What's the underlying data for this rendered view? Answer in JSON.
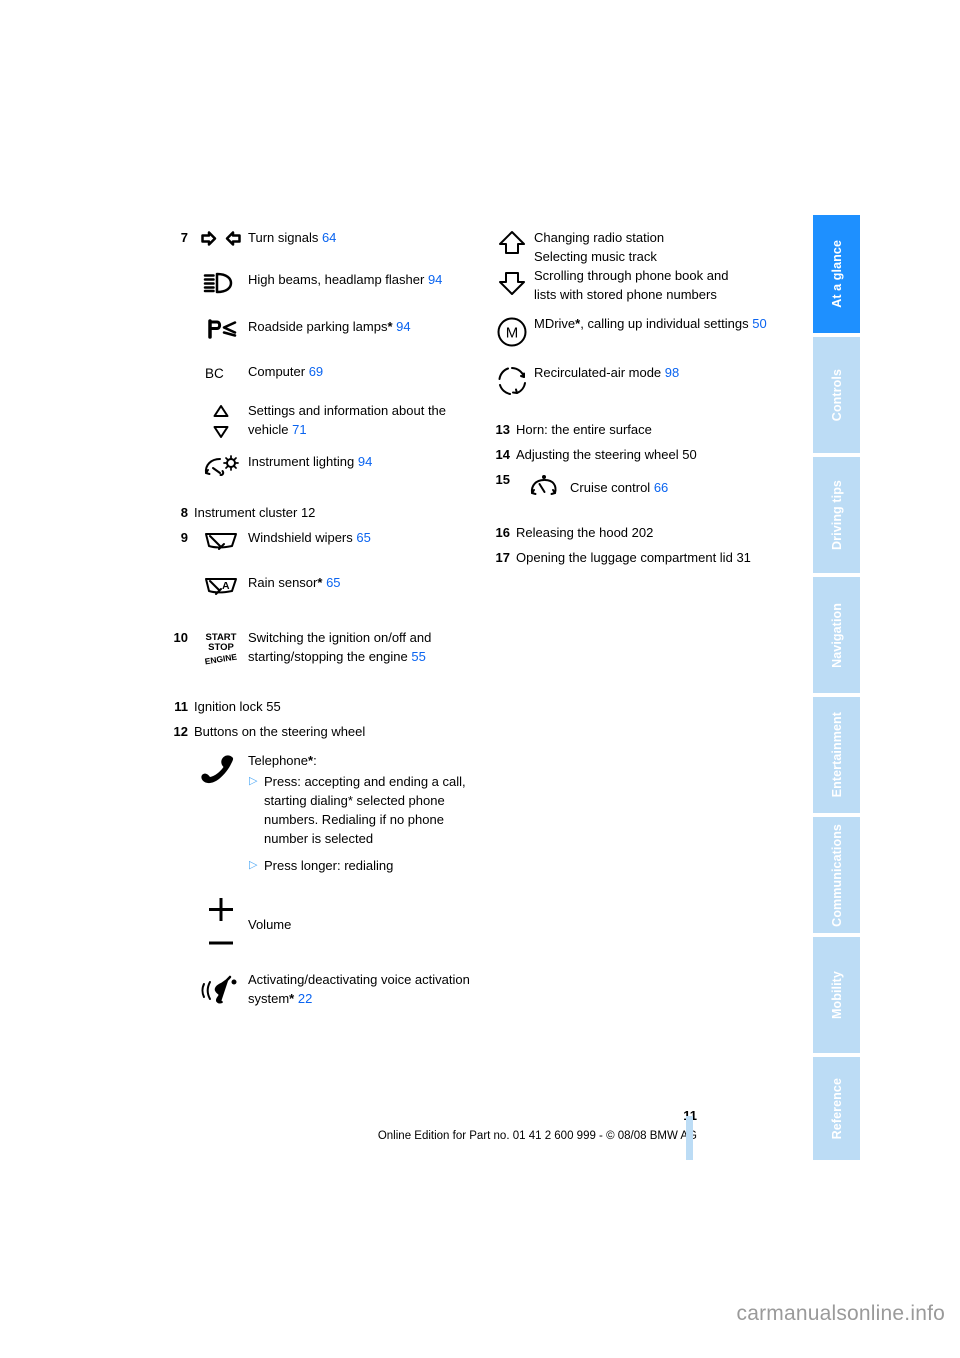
{
  "sidebar": {
    "tabs": [
      {
        "label": "At a glance",
        "active": true
      },
      {
        "label": "Controls",
        "active": false
      },
      {
        "label": "Driving tips",
        "active": false
      },
      {
        "label": "Navigation",
        "active": false
      },
      {
        "label": "Entertainment",
        "active": false
      },
      {
        "label": "Communications",
        "active": false
      },
      {
        "label": "Mobility",
        "active": false
      },
      {
        "label": "Reference",
        "active": false
      }
    ],
    "active_color": "#1e90ff",
    "inactive_color": "#bcdcf5"
  },
  "colors": {
    "reference_link": "#0a64f0",
    "bullet_triangle": "#4ea8f5",
    "watermark": "#9a9a9a"
  },
  "left_column": {
    "item7": {
      "number": "7",
      "entries": [
        {
          "icon": "turn-signals-icon",
          "label": "Turn signals",
          "ref": "64"
        },
        {
          "icon": "high-beams-icon",
          "label": "High beams, headlamp flasher",
          "ref": "94"
        },
        {
          "icon": "roadside-parking-lamps-icon",
          "label": "Roadside parking lamps",
          "star": "*",
          "ref": "94"
        },
        {
          "icon": "bc-computer-icon",
          "label": "Computer",
          "ref": "69"
        },
        {
          "icon": "up-down-arrows-icon",
          "label": "Settings and information about the vehicle",
          "ref": "71"
        },
        {
          "icon": "instrument-lighting-icon",
          "label": "Instrument lighting",
          "ref": "94"
        }
      ]
    },
    "item8": {
      "number": "8",
      "label": "Instrument cluster",
      "ref": "12"
    },
    "item9": {
      "number": "9",
      "entries": [
        {
          "icon": "windshield-wipers-icon",
          "label": "Windshield wipers",
          "ref": "65"
        },
        {
          "icon": "rain-sensor-icon",
          "label": "Rain sensor",
          "star": "*",
          "ref": "65"
        }
      ]
    },
    "item10": {
      "number": "10",
      "icon": "start-stop-engine-icon",
      "icon_text": {
        "line1": "START",
        "line2": "STOP",
        "line3": "ENGINE"
      },
      "label": "Switching the ignition on/off and starting/stopping the engine",
      "ref": "55"
    },
    "item11": {
      "number": "11",
      "label": "Ignition lock",
      "ref": "55"
    },
    "item12": {
      "number": "12",
      "label": "Buttons on the steering wheel",
      "telephone": {
        "icon": "telephone-handset-icon",
        "label": "Telephone",
        "star": "*",
        "colon": ":",
        "bullets": [
          "Press: accepting and ending a call, starting dialing* selected phone numbers. Redialing if no phone number is selected",
          "Press longer: redialing"
        ]
      },
      "volume": {
        "icon": "volume-plus-minus-icon",
        "label": "Volume"
      },
      "voice": {
        "icon": "voice-activation-icon",
        "label": "Activating/deactivating voice activation system",
        "star": "*",
        "ref": "22"
      }
    }
  },
  "right_column": {
    "arrows": {
      "icon_up": "arrow-up-icon",
      "icon_down": "arrow-down-icon",
      "lines": [
        "Changing radio station",
        "Selecting music track",
        "Scrolling through phone book and",
        "lists with stored phone numbers"
      ]
    },
    "mdrive": {
      "icon": "mdrive-m-icon",
      "label": "MDrive",
      "star": "*",
      "label2": ", calling up individual settings",
      "ref": "50"
    },
    "recirculated": {
      "icon": "recirculated-air-icon",
      "label": "Recirculated-air mode",
      "ref": "98"
    },
    "item13": {
      "number": "13",
      "label": "Horn: the entire surface"
    },
    "item14": {
      "number": "14",
      "label": "Adjusting the steering wheel",
      "ref": "50"
    },
    "item15": {
      "number": "15",
      "icon": "cruise-control-icon",
      "label": "Cruise control",
      "ref": "66"
    },
    "item16": {
      "number": "16",
      "label": "Releasing the hood",
      "ref": "202"
    },
    "item17": {
      "number": "17",
      "label": "Opening the luggage compartment lid",
      "ref": "31"
    }
  },
  "footer": {
    "page_number": "11",
    "imprint": "Online Edition for Part no. 01 41 2 600 999 - © 08/08 BMW AG"
  },
  "watermark": "carmanualsonline.info"
}
